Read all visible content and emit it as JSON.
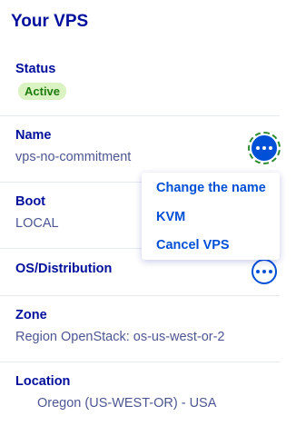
{
  "panel": {
    "title": "Your VPS"
  },
  "status": {
    "label": "Status",
    "badge": "Active"
  },
  "name": {
    "label": "Name",
    "value": "vps-no-commitment"
  },
  "boot": {
    "label": "Boot",
    "value": "LOCAL"
  },
  "os": {
    "label": "OS/Distribution"
  },
  "zone": {
    "label": "Zone",
    "value": "Region OpenStack: os-us-west-or-2"
  },
  "location": {
    "label": "Location",
    "value": "Oregon (US-WEST-OR) - USA"
  },
  "menu": {
    "items": [
      {
        "label": "Change the name"
      },
      {
        "label": "KVM"
      },
      {
        "label": "Cancel VPS"
      }
    ]
  },
  "icons": {
    "name_actions": "more-options-icon",
    "os_actions": "more-options-icon"
  },
  "colors": {
    "primary": "#000e9c",
    "action": "#0050d7",
    "badge_bg": "#dbf2c2",
    "badge_text": "#1d7c0d",
    "focus_ring": "#2d8a2d"
  }
}
